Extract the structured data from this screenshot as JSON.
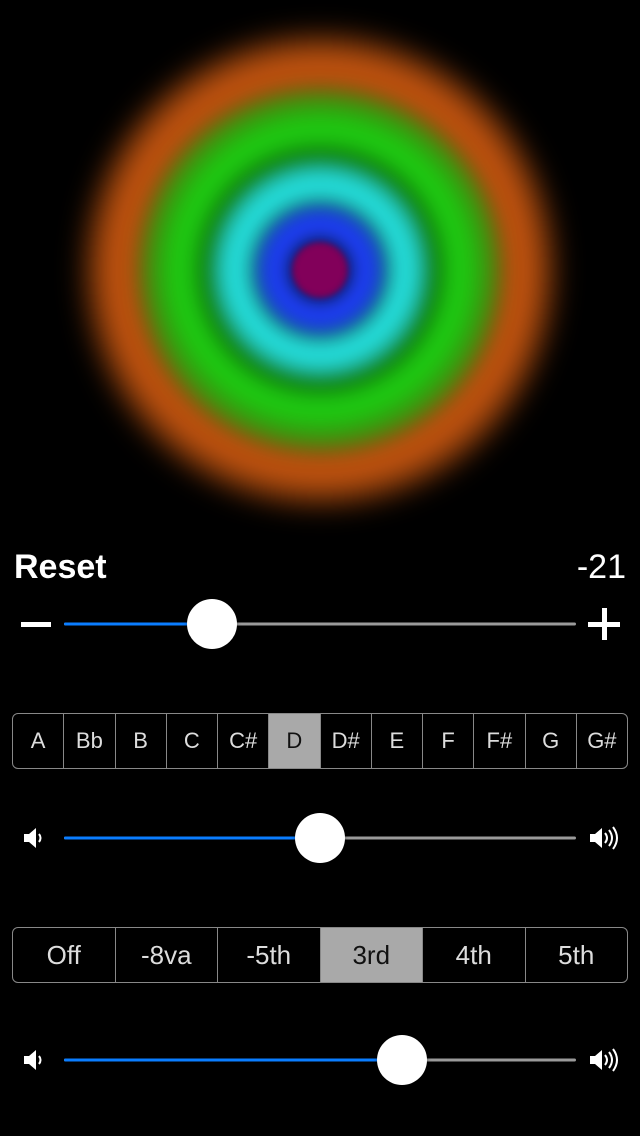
{
  "reset_label": "Reset",
  "cents_value": "-21",
  "cents_slider": {
    "min": -50,
    "max": 50,
    "value": -21,
    "fill_pct": 29,
    "thumb_pct": 29
  },
  "notes": [
    "A",
    "Bb",
    "B",
    "C",
    "C#",
    "D",
    "D#",
    "E",
    "F",
    "F#",
    "G",
    "G#"
  ],
  "selected_note_index": 5,
  "volume1": {
    "fill_pct": 50,
    "thumb_pct": 50
  },
  "intervals": [
    "Off",
    "-8va",
    "-5th",
    "3rd",
    "4th",
    "5th"
  ],
  "selected_interval_index": 3,
  "volume2": {
    "fill_pct": 66,
    "thumb_pct": 66
  },
  "colors": {
    "accent": "#0a7dff"
  }
}
